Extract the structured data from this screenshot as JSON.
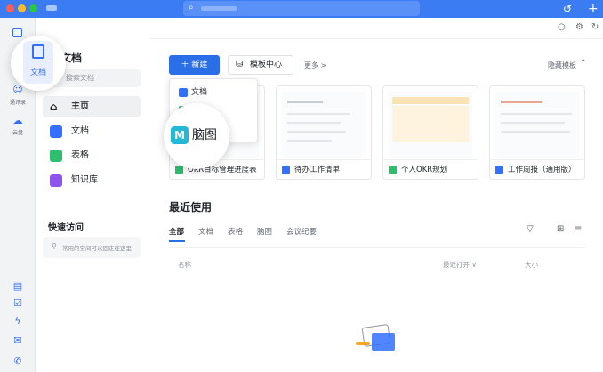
{
  "colors": {
    "accent": "#2a6ee8",
    "titlebar": "#3b7cf3",
    "doc": "#3370ff",
    "sheet": "#2fbe6d",
    "wiki": "#8d55ed",
    "mindmap": "#25b8d6"
  },
  "rail": {
    "items": [
      {
        "label": "文档"
      },
      {
        "label": "通讯录"
      },
      {
        "label": "云盘"
      }
    ]
  },
  "sidebar": {
    "title": "文档",
    "search_placeholder": "搜索文档",
    "nav": [
      {
        "label": "主页",
        "icon": "home-icon"
      },
      {
        "label": "文档",
        "icon": "doc-icon"
      },
      {
        "label": "表格",
        "icon": "sheet-icon"
      },
      {
        "label": "知识库",
        "icon": "wiki-icon"
      }
    ],
    "quick_access_title": "快速访问",
    "quick_access_hint": "常用的空间可以固定在这里"
  },
  "toolbar": {
    "new_label": "新建",
    "template_label": "模板中心",
    "more_label": "更多 >",
    "collapse_label": "隐藏模板"
  },
  "dropdown": {
    "items": [
      {
        "label": "文档"
      },
      {
        "label": "表格"
      }
    ]
  },
  "magnified": {
    "rail_label": "文档",
    "mindmap_label": "脑图"
  },
  "templates": [
    {
      "title": "OKR目标管理进度表",
      "kind": "sheet"
    },
    {
      "title": "待办工作清单",
      "kind": "doc"
    },
    {
      "title": "个人OKR规划",
      "kind": "sheet"
    },
    {
      "title": "工作周报（通用版）",
      "kind": "doc"
    }
  ],
  "recent": {
    "title": "最近使用",
    "tabs": [
      "全部",
      "文档",
      "表格",
      "脑图",
      "会议纪要"
    ],
    "columns": {
      "name": "名称",
      "opened": "最近打开 ∨",
      "size": "大小"
    }
  }
}
